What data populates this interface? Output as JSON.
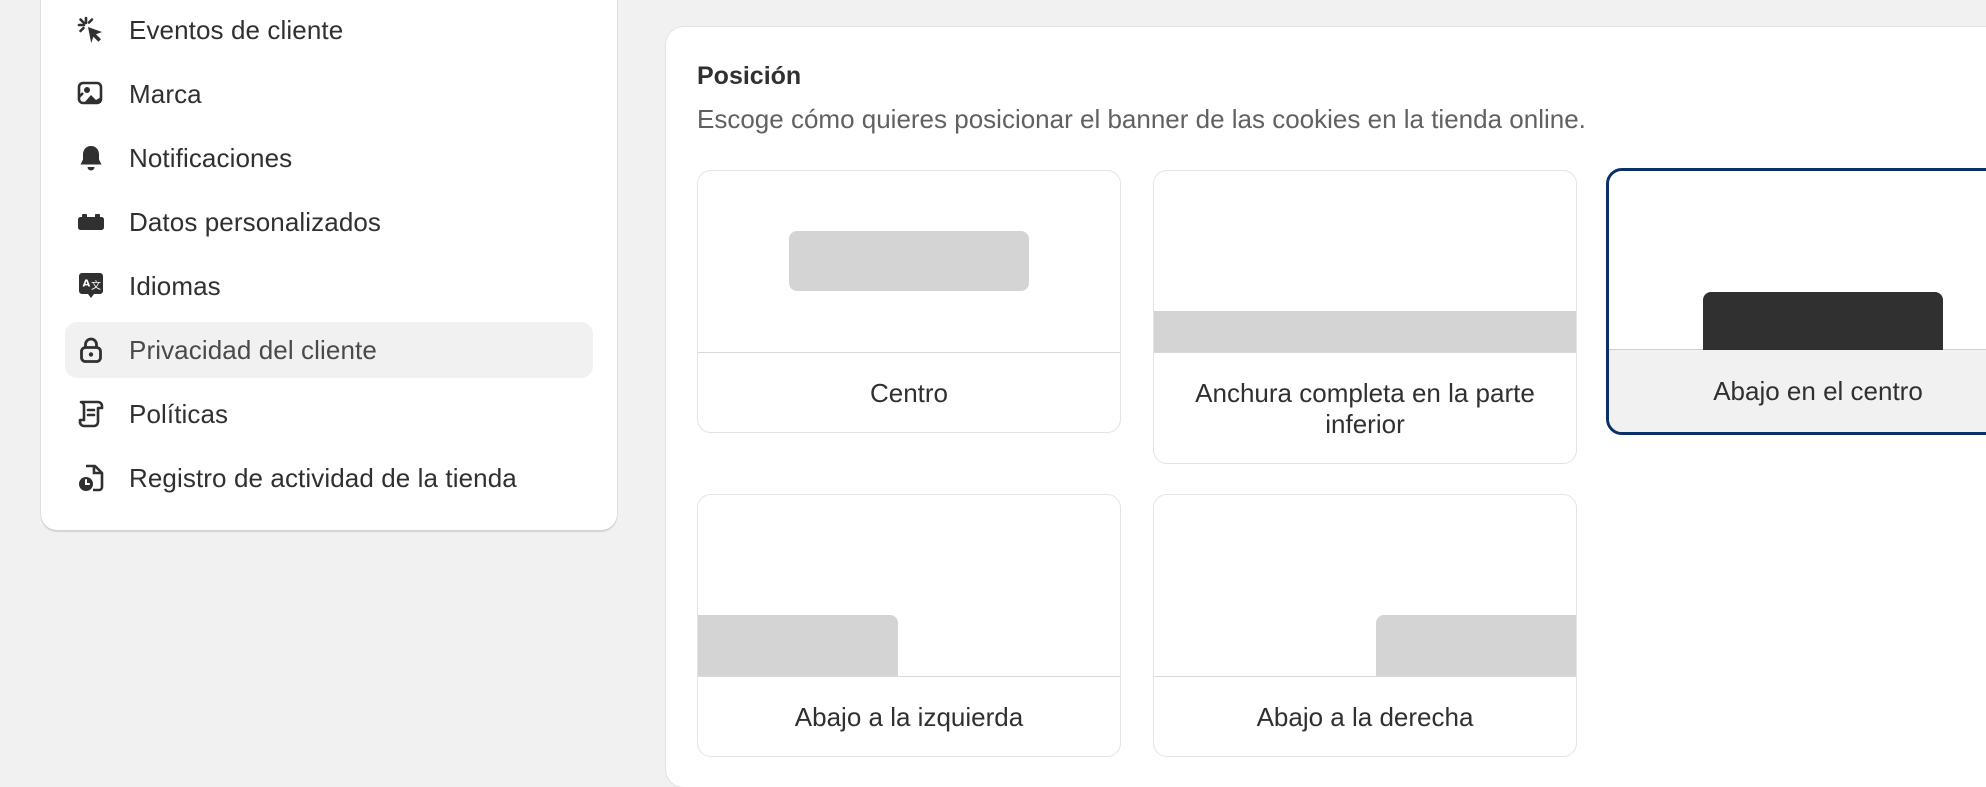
{
  "sidebar": {
    "items": [
      {
        "label": "Eventos de cliente",
        "icon": "cursor-click-icon"
      },
      {
        "label": "Marca",
        "icon": "brand-image-icon"
      },
      {
        "label": "Notificaciones",
        "icon": "bell-icon"
      },
      {
        "label": "Datos personalizados",
        "icon": "blocks-icon"
      },
      {
        "label": "Idiomas",
        "icon": "translate-icon"
      },
      {
        "label": "Privacidad del cliente",
        "icon": "lock-icon",
        "active": true
      },
      {
        "label": "Políticas",
        "icon": "scroll-icon"
      },
      {
        "label": "Registro de actividad de la tienda",
        "icon": "activity-log-icon"
      }
    ]
  },
  "position_section": {
    "title": "Posición",
    "description": "Escoge cómo quieres posicionar el banner de las cookies en la tienda online.",
    "options": [
      {
        "label": "Centro",
        "selected": false
      },
      {
        "label": "Anchura completa en la parte inferior",
        "selected": false
      },
      {
        "label": "Abajo en el centro",
        "selected": true
      },
      {
        "label": "Abajo a la izquierda",
        "selected": false
      },
      {
        "label": "Abajo a la derecha",
        "selected": false
      }
    ]
  },
  "colors": {
    "selected_border": "#0b2f6a",
    "banner_preview": "#d4d4d4",
    "banner_preview_selected": "#303030",
    "page_background": "#f1f1f1"
  }
}
